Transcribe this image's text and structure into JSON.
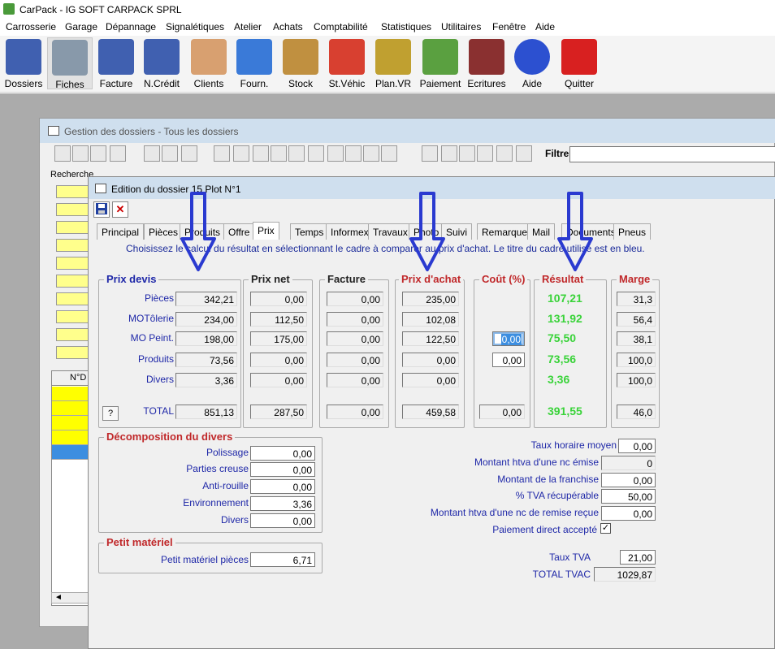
{
  "app": {
    "title": "CarPack - IG SOFT CARPACK SPRL"
  },
  "menu": [
    "Carrosserie",
    "Garage",
    "Dépannage",
    "Signalétiques",
    "Atelier",
    "Achats",
    "Comptabilité",
    "Statistiques",
    "Utilitaires",
    "Fenêtre",
    "Aide"
  ],
  "toolbar": [
    {
      "label": "Dossiers",
      "icon": "folder-icon",
      "color": "#4060b0"
    },
    {
      "label": "Fiches",
      "icon": "tools-icon",
      "color": "#8899aa"
    },
    {
      "label": "Facture",
      "icon": "invoice-icon",
      "color": "#4060b0"
    },
    {
      "label": "N.Crédit",
      "icon": "credit-note-icon",
      "color": "#4060b0"
    },
    {
      "label": "Clients",
      "icon": "client-icon",
      "color": "#d8a070"
    },
    {
      "label": "Fourn.",
      "icon": "truck-icon",
      "color": "#3a7ad8"
    },
    {
      "label": "Stock",
      "icon": "boxes-icon",
      "color": "#c09040"
    },
    {
      "label": "St.Véhic",
      "icon": "cars-icon",
      "color": "#d84030"
    },
    {
      "label": "Plan.VR",
      "icon": "keys-icon",
      "color": "#c0a030"
    },
    {
      "label": "Paiement",
      "icon": "money-icon",
      "color": "#5aa040"
    },
    {
      "label": "Ecritures",
      "icon": "books-icon",
      "color": "#8a3030"
    },
    {
      "label": "Aide",
      "icon": "help-icon",
      "color": "#2c50d0"
    },
    {
      "label": "Quitter",
      "icon": "power-icon",
      "color": "#d82020"
    }
  ],
  "gestion": {
    "title": "Gestion des dossiers - Tous les dossiers",
    "filtre_label": "Filtre",
    "recherche_label": "Recherche",
    "grid_header": "N°D"
  },
  "edition": {
    "title": "Edition du dossier 15  Plot N°1",
    "tabs": [
      "Principal",
      "Pièces",
      "Produits",
      "Offre",
      "Prix",
      "Temps",
      "Informex",
      "Travaux",
      "Photo",
      "Suivi",
      "Remarque",
      "Mail",
      "Documents",
      "Pneus"
    ],
    "active_tab": "Prix",
    "hint": "Choisissez le calcul du résultat en sélectionnant le cadre à comparer au prix d'achat. Le titre du cadre utilisé est en bleu.",
    "row_labels": [
      "Pièces",
      "MOTôlerie",
      "MO Peint.",
      "Produits",
      "Divers",
      "TOTAL"
    ],
    "help_btn": "?",
    "prix_devis": {
      "title": "Prix devis",
      "values": [
        "342,21",
        "234,00",
        "198,00",
        "73,56",
        "3,36"
      ],
      "total": "851,13"
    },
    "prix_net": {
      "title": "Prix net",
      "values": [
        "0,00",
        "112,50",
        "175,00",
        "0,00",
        "0,00"
      ],
      "total": "287,50"
    },
    "facture": {
      "title": "Facture",
      "values": [
        "0,00",
        "0,00",
        "0,00",
        "0,00",
        "0,00"
      ],
      "total": "0,00"
    },
    "prix_achat": {
      "title": "Prix d'achat",
      "values": [
        "235,00",
        "102,08",
        "122,50",
        "0,00",
        "0,00"
      ],
      "total": "459,58"
    },
    "cout": {
      "title": "Coût (%)",
      "values": [
        "0,00",
        "0,00"
      ],
      "total": "0,00"
    },
    "resultat": {
      "title": "Résultat",
      "values": [
        "107,21",
        "131,92",
        "75,50",
        "73,56",
        "3,36"
      ],
      "total": "391,55"
    },
    "marge": {
      "title": "Marge",
      "values": [
        "31,3",
        "56,4",
        "38,1",
        "100,0",
        "100,0"
      ],
      "total": "46,0"
    },
    "divers": {
      "title": "Décomposition du divers",
      "rows": [
        {
          "label": "Polissage",
          "value": "0,00"
        },
        {
          "label": "Parties creuse",
          "value": "0,00"
        },
        {
          "label": "Anti-rouille",
          "value": "0,00"
        },
        {
          "label": "Environnement",
          "value": "3,36"
        },
        {
          "label": "Divers",
          "value": "0,00"
        }
      ]
    },
    "petit": {
      "title": "Petit matériel",
      "label": "Petit matériel pièces",
      "value": "6,71"
    },
    "right": [
      {
        "label": "Taux horaire moyen",
        "value": "0,00"
      },
      {
        "label": "Montant htva d'une nc émise",
        "value": "0"
      },
      {
        "label": "Montant de la franchise",
        "value": "0,00"
      },
      {
        "label": "% TVA récupérable",
        "value": "50,00"
      },
      {
        "label": "Montant htva d'une nc de remise reçue",
        "value": "0,00"
      }
    ],
    "paiement_direct": {
      "label": "Paiement direct accepté",
      "checked": "✓"
    },
    "taux_tva": {
      "label": "Taux TVA",
      "value": "21,00"
    },
    "total_tvac": {
      "label": "TOTAL TVAC",
      "value": "1029,87"
    }
  }
}
